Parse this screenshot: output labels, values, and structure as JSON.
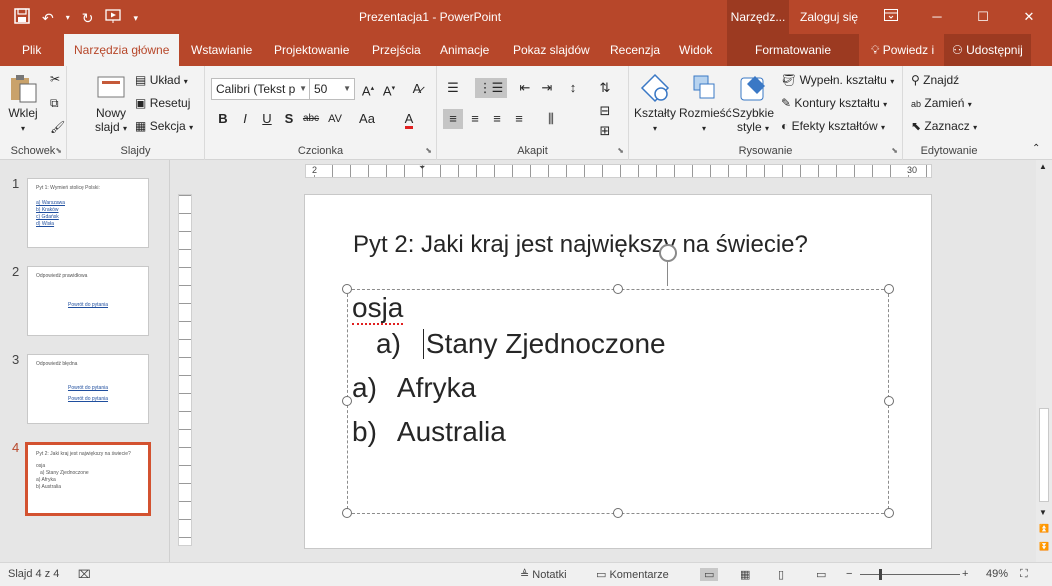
{
  "window": {
    "title": "Prezentacja1 - PowerPoint",
    "context_tab_title": "Narzędz...",
    "login_label": "Zaloguj się",
    "accent_color": "#b7472a"
  },
  "qat": {
    "save_icon": "save-icon",
    "undo_icon": "undo-icon",
    "redo_icon": "redo-icon",
    "present_icon": "present-from-start-icon",
    "customize_icon": "customize-qat-icon"
  },
  "tabs": {
    "plik": "Plik",
    "home": "Narzędzia główne",
    "insert": "Wstawianie",
    "design": "Projektowanie",
    "transitions": "Przejścia",
    "animations": "Animacje",
    "slideshow": "Pokaz slajdów",
    "review": "Recenzja",
    "view": "Widok",
    "format": "Formatowanie",
    "tellme": "Powiedz i",
    "share": "Udostępnij"
  },
  "ribbon": {
    "clipboard": {
      "paste": "Wklej",
      "label": "Schowek"
    },
    "slides": {
      "new_slide_1": "Nowy",
      "new_slide_2": "slajd",
      "layout": "Układ",
      "reset": "Resetuj",
      "section": "Sekcja",
      "label": "Slajdy"
    },
    "font": {
      "name": "Calibri (Tekst p",
      "size": "50",
      "label": "Czcionka"
    },
    "paragraph": {
      "label": "Akapit"
    },
    "drawing": {
      "shapes": "Kształty",
      "arrange": "Rozmieść",
      "quick_styles_1": "Szybkie",
      "quick_styles_2": "style",
      "fill": "Wypełn. kształtu",
      "outline": "Kontury kształtu",
      "effects": "Efekty kształtów",
      "label": "Rysowanie"
    },
    "editing": {
      "find": "Znajdź",
      "replace": "Zamień",
      "select": "Zaznacz",
      "label": "Edytowanie"
    }
  },
  "thumbnails": [
    {
      "number": "1",
      "title": "Pyt 1: Wymień stolicę Polski:",
      "items": [
        "a)   Warszawa",
        "b)   Kraków",
        "c)   Gdańsk",
        "d)   Wisła"
      ]
    },
    {
      "number": "2",
      "title": "Odpowiedź prawidłowa",
      "items": [
        "Powrót do pytania"
      ]
    },
    {
      "number": "3",
      "title": "Odpowiedź błędna",
      "items": [
        "Powrót do pytania",
        "Powrót do pytania"
      ]
    },
    {
      "number": "4",
      "title": "Pyt 2: Jaki kraj jest największy na świecie?",
      "items": [
        "osja",
        "a)   Stany Zjednoczone",
        "a)   Afryka",
        "b)   Australia"
      ]
    }
  ],
  "ruler": {
    "h_left": "2",
    "h_right": "30"
  },
  "slide": {
    "title": "Pyt 2: Jaki kraj jest największy na świecie?",
    "body": {
      "line0": "osja",
      "line1_marker": "a)",
      "line1_text": "Stany Zjednoczone",
      "line2_marker": "a)",
      "line2_text": "Afryka",
      "line3_marker": "b)",
      "line3_text": "Australia"
    }
  },
  "status": {
    "slide_info": "Slajd 4 z 4",
    "notes": "Notatki",
    "comments": "Komentarze",
    "zoom": "49%"
  }
}
